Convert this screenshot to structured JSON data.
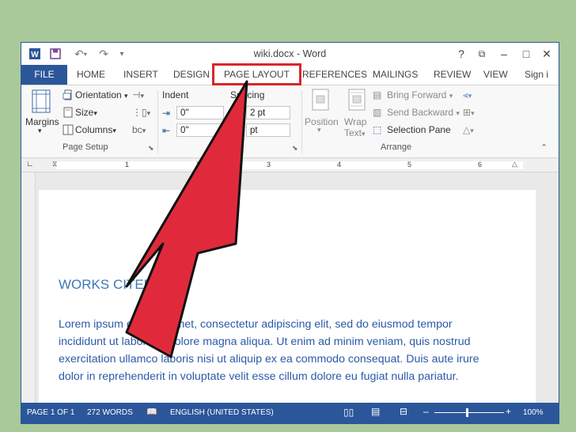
{
  "window": {
    "title": "wiki.docx - Word"
  },
  "titlebar": {
    "help": "?",
    "minimize": "–",
    "restore": "□",
    "close": "✕"
  },
  "tabs": [
    "FILE",
    "HOME",
    "INSERT",
    "DESIGN",
    "PAGE LAYOUT",
    "REFERENCES",
    "MAILINGS",
    "REVIEW",
    "VIEW",
    "Sign i"
  ],
  "active_tab": "PAGE LAYOUT",
  "ribbon": {
    "margins": "Margins",
    "orientation": "Orientation",
    "size": "Size",
    "columns": "Columns",
    "page_setup": "Page Setup",
    "indent": "Indent",
    "indent_left": "0\"",
    "indent_right": "0\"",
    "spacing": "Spacing",
    "spacing_before": "2 pt",
    "spacing_after": "pt",
    "position": "Position",
    "wrap": "Wrap",
    "wrap2": "Text",
    "bring_forward": "Bring Forward",
    "send_backward": "Send Backward",
    "selection_pane": "Selection Pane",
    "arrange": "Arrange"
  },
  "ruler": {
    "marks": [
      "1",
      "2",
      "3",
      "4",
      "5",
      "6"
    ]
  },
  "document": {
    "heading": "WORKS CITED",
    "lines": [
      "Lorem ipsum dolor sit amet, consectetur adipiscing elit, sed do eiusmod tempor",
      "incididunt ut labore et dolore magna aliqua. Ut enim ad minim veniam, quis nostrud",
      "exercitation ullamco laboris nisi ut aliquip ex ea commodo consequat. Duis aute irure",
      "dolor in reprehenderit in voluptate velit esse cillum dolore eu fugiat nulla pariatur."
    ]
  },
  "status": {
    "page": "PAGE 1 OF 1",
    "words": "272 WORDS",
    "language": "ENGLISH (UNITED STATES)",
    "zoom": "100%"
  },
  "colors": {
    "accent": "#2b579a",
    "highlight": "#d9262a",
    "arrow": "#e02a3c"
  }
}
